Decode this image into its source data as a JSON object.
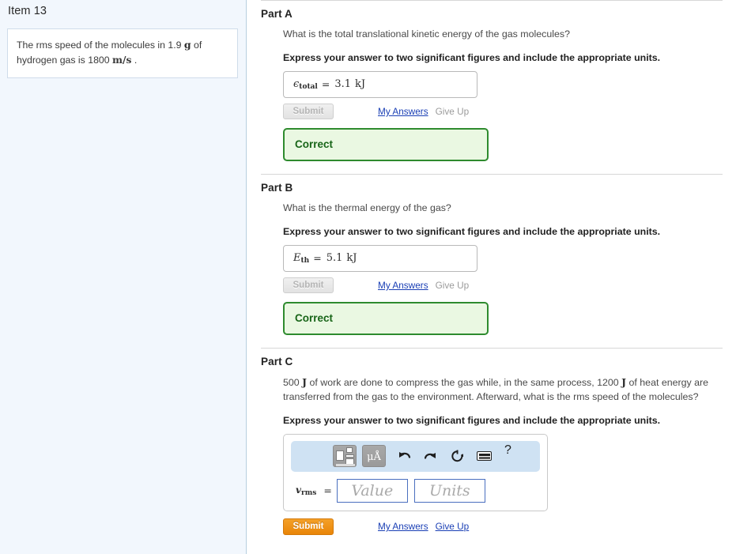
{
  "sidebar": {
    "item_title": "Item 13",
    "question": {
      "line1_pre": "The rms speed of the molecules in 1.9 ",
      "line1_unit": "g",
      "line1_post": " of",
      "line2_pre": "hydrogen gas is 1800 ",
      "line2_unit": "m/s",
      "line2_post": " ."
    }
  },
  "parts": [
    {
      "title": "Part A",
      "prompt": "What is the total translational kinetic energy of the gas molecules?",
      "instruction": "Express your answer to two significant figures and include the appropriate units.",
      "answer": {
        "symbol": "ϵ",
        "subscript": "total",
        "equals": "=",
        "value": "3.1",
        "unit": "kJ"
      },
      "submit_label": "Submit",
      "submit_enabled": false,
      "my_answers_label": "My Answers",
      "give_up_label": "Give Up",
      "give_up_enabled": false,
      "status": "Correct"
    },
    {
      "title": "Part B",
      "prompt": "What is the thermal energy of the gas?",
      "instruction": "Express your answer to two significant figures and include the appropriate units.",
      "answer": {
        "symbol": "E",
        "subscript": "th",
        "equals": "=",
        "value": "5.1",
        "unit": "kJ"
      },
      "submit_label": "Submit",
      "submit_enabled": false,
      "my_answers_label": "My Answers",
      "give_up_label": "Give Up",
      "give_up_enabled": false,
      "status": "Correct"
    },
    {
      "title": "Part C",
      "prompt_seg1": "500 ",
      "prompt_unit1": "J",
      "prompt_seg2": " of work are done to compress the gas while, in the same process, 1200 ",
      "prompt_unit2": "J",
      "prompt_seg3": " of heat energy are transferred from the gas to the environment. Afterward, what is the rms speed of the molecules?",
      "instruction": "Express your answer to two significant figures and include the appropriate units.",
      "entry": {
        "symbol": "v",
        "subscript": "rms",
        "equals": "=",
        "value_placeholder": "Value",
        "units_placeholder": "Units"
      },
      "toolbar": {
        "template_button": "math-template",
        "unit_button": "μÅ",
        "undo": "↶",
        "redo": "↷",
        "reset": "↻",
        "keyboard": "keyboard",
        "help": "?"
      },
      "submit_label": "Submit",
      "submit_enabled": true,
      "my_answers_label": "My Answers",
      "give_up_label": "Give Up",
      "give_up_enabled": true
    }
  ],
  "colors": {
    "sidebar_bg": "#f2f7fd",
    "correct_border": "#2e8b2e",
    "correct_bg": "#eaf8e2",
    "correct_text": "#186518",
    "submit_active": "#ef8f14",
    "link": "#1a3fb5",
    "toolbar_bg": "#cfe2f3",
    "field_border": "#4a6fbf"
  }
}
